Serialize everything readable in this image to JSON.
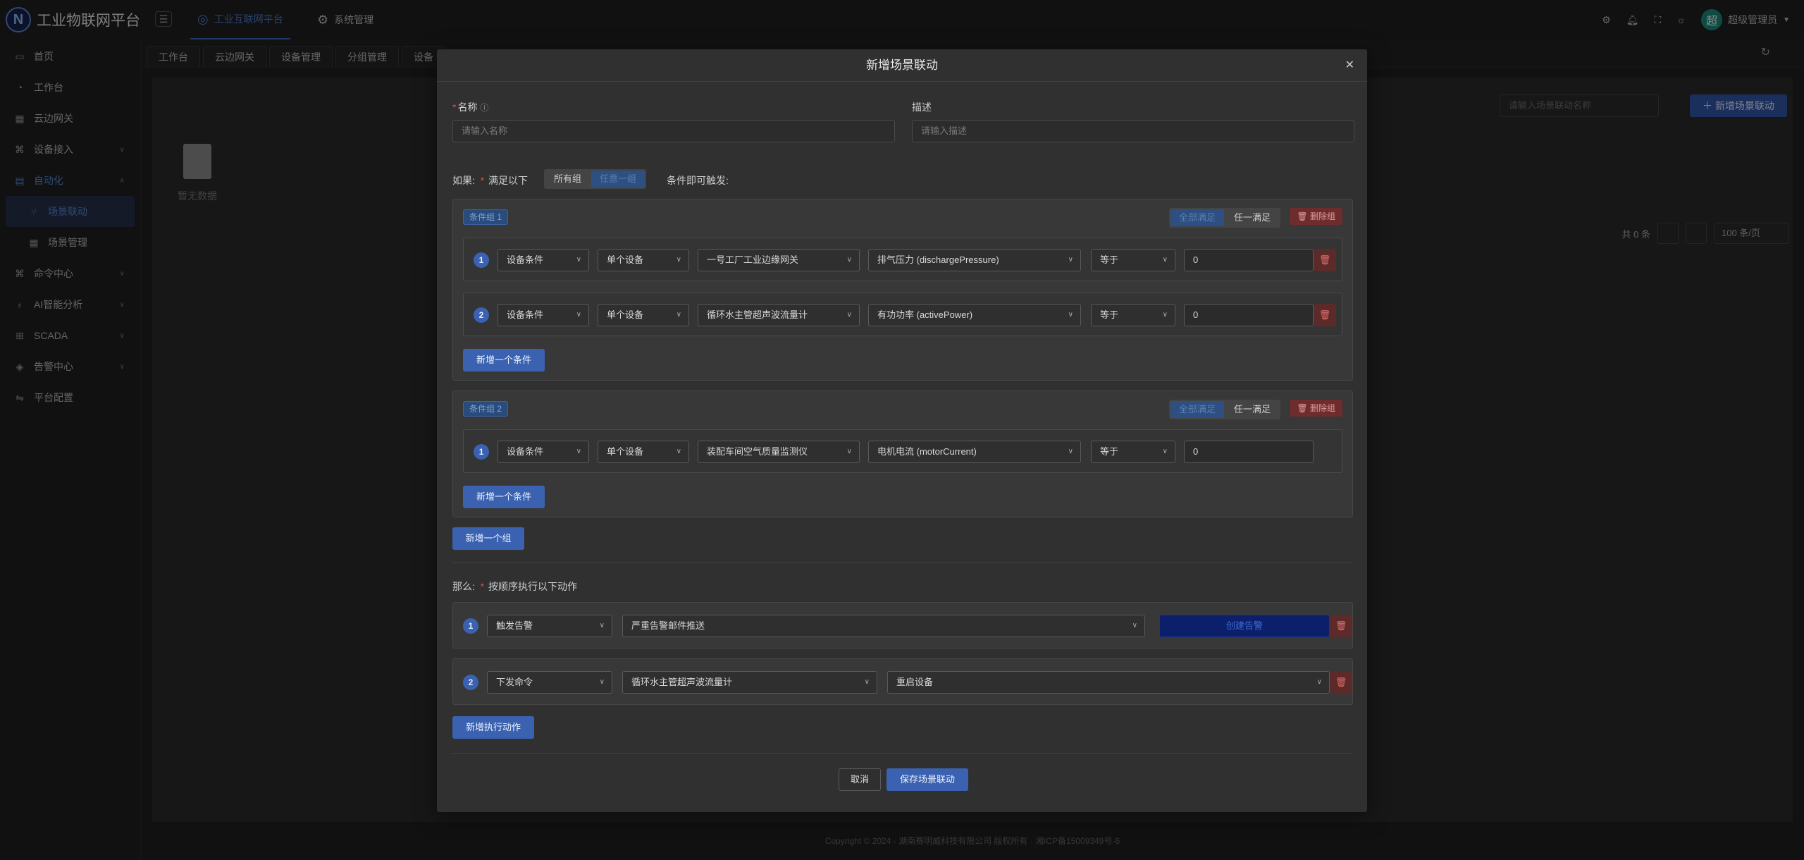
{
  "app": {
    "logo_letter": "N",
    "title": "工业物联网平台"
  },
  "topnav": {
    "platform": "工业互联网平台",
    "system": "系统管理",
    "user": "超级管理员",
    "avatar_text": "超"
  },
  "sidebar": {
    "items": [
      {
        "label": "首页",
        "icon": "monitor-icon"
      },
      {
        "label": "工作台",
        "icon": "dashboard-icon"
      },
      {
        "label": "云边网关",
        "icon": "gateway-icon"
      },
      {
        "label": "设备接入",
        "icon": "device-icon"
      },
      {
        "label": "自动化",
        "icon": "automation-icon"
      },
      {
        "label": "场景联动",
        "icon": "link-icon"
      },
      {
        "label": "场景管理",
        "icon": "grid-icon"
      },
      {
        "label": "命令中心",
        "icon": "command-icon"
      },
      {
        "label": "AI智能分析",
        "icon": "bulb-icon"
      },
      {
        "label": "SCADA",
        "icon": "scada-icon"
      },
      {
        "label": "告警中心",
        "icon": "alarm-icon"
      },
      {
        "label": "平台配置",
        "icon": "config-icon"
      }
    ]
  },
  "tabs": [
    "工作台",
    "云边网关",
    "设备管理",
    "分组管理",
    "设备"
  ],
  "main": {
    "search_placeholder": "请输入场景联动名称",
    "add_button": "新增场景联动",
    "empty_text": "暂无数据",
    "total": "共 0 条",
    "page_size": "100 条/页"
  },
  "footer": {
    "text": "Copyright © 2024 - 湖南赛明威科技有限公司 版权所有 · 湘ICP备15009349号-6"
  },
  "modal": {
    "title": "新增场景联动",
    "name_label": "名称",
    "name_placeholder": "请输入名称",
    "desc_label": "描述",
    "desc_placeholder": "请输入描述",
    "if_label": "如果:",
    "satisfy_label": "满足以下",
    "trigger_suffix": "条件即可触发:",
    "mode_all": "所有组",
    "mode_any": "任意一组",
    "group_mode_all": "全部满足",
    "group_mode_any": "任一满足",
    "delete_group": "删除组",
    "add_condition": "新增一个条件",
    "add_group": "新增一个组",
    "then_label": "那么:",
    "then_desc": "按顺序执行以下动作",
    "add_action": "新增执行动作",
    "cancel": "取消",
    "save": "保存场景联动",
    "groups": [
      {
        "tag": "条件组 1",
        "conditions": [
          {
            "n": "1",
            "type": "设备条件",
            "scope": "单个设备",
            "device": "一号工厂工业边缘网关",
            "prop": "排气压力 (dischargePressure)",
            "op": "等于",
            "value": "0"
          },
          {
            "n": "2",
            "type": "设备条件",
            "scope": "单个设备",
            "device": "循环水主管超声波流量计",
            "prop": "有功功率 (activePower)",
            "op": "等于",
            "value": "0"
          }
        ]
      },
      {
        "tag": "条件组 2",
        "conditions": [
          {
            "n": "1",
            "type": "设备条件",
            "scope": "单个设备",
            "device": "装配车间空气质量监测仪",
            "prop": "电机电流 (motorCurrent)",
            "op": "等于",
            "value": "0"
          }
        ]
      }
    ],
    "actions": [
      {
        "n": "1",
        "type": "触发告警",
        "target": "严重告警邮件推送",
        "button": "创建告警"
      },
      {
        "n": "2",
        "type": "下发命令",
        "target": "循环水主管超声波流量计",
        "command": "重启设备"
      }
    ]
  }
}
